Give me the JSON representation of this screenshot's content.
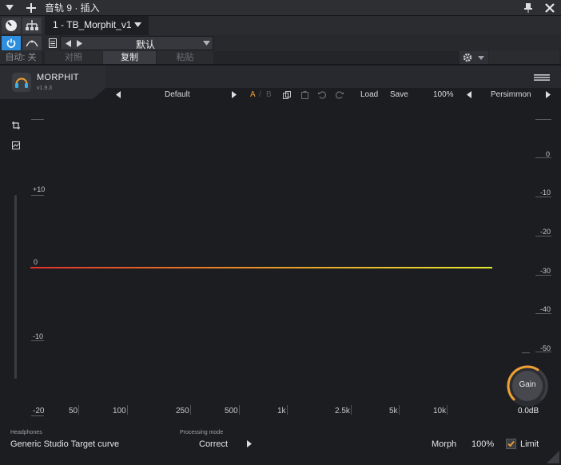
{
  "host": {
    "title": "音轨 9 · 插入",
    "plugin_slot": "1 - TB_Morphit_v1",
    "preset": "默认",
    "auto_label": "自动: 关",
    "compare_label": "对照",
    "copy_label": "复制",
    "paste_label": "粘贴",
    "accent": "#2e8fe0"
  },
  "plugin": {
    "name": "MORPHIT",
    "version": "v1.9.3",
    "preset_name": "Default",
    "ab_a": "A",
    "ab_sep": "/",
    "ab_b": "B",
    "load_label": "Load",
    "save_label": "Save",
    "zoom": "100%",
    "theme": "Persimmon",
    "accent_orange": "#f0a030"
  },
  "graph": {
    "left_db_labels": [
      "+10",
      "0",
      "-10",
      "-20"
    ],
    "right_db_labels": [
      "0",
      "-10",
      "-20",
      "-30",
      "-40",
      "-50"
    ],
    "freq_labels": [
      "50",
      "100",
      "250",
      "500",
      "1k",
      "2.5k",
      "5k",
      "10k"
    ],
    "meter_dash": "__"
  },
  "gain": {
    "label": "Gain",
    "value": "0.0dB",
    "level": 0.62
  },
  "footer": {
    "headphones_label": "Headphones",
    "headphones_value": "Generic Studio Target curve",
    "mode_label": "Processing mode",
    "mode_value": "Correct",
    "morph_label": "Morph",
    "morph_value": "100%",
    "limit_label": "Limit",
    "limit_checked": true
  }
}
